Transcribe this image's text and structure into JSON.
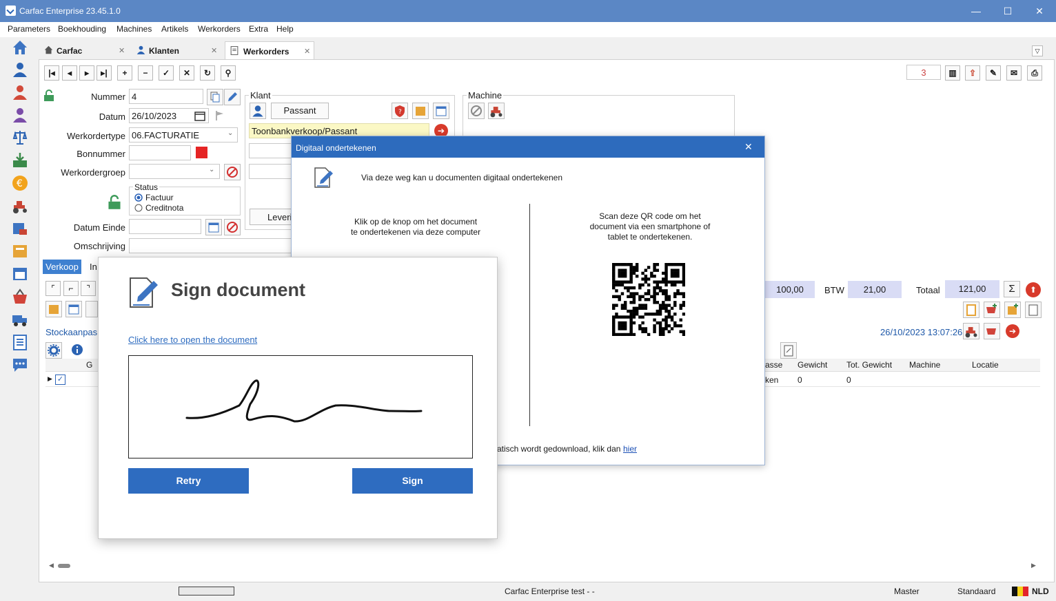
{
  "window": {
    "title": "Carfac Enterprise 23.45.1.0",
    "minimize": "—",
    "maximize": "☐",
    "close": "✕"
  },
  "menu": [
    "Parameters",
    "Boekhouding",
    "Machines",
    "Artikels",
    "Werkorders",
    "Extra",
    "Help"
  ],
  "tabs": [
    {
      "label": "Carfac",
      "icon": "home-icon"
    },
    {
      "label": "Klanten",
      "icon": "user-icon"
    },
    {
      "label": "Werkorders",
      "icon": "document-icon",
      "active": true
    }
  ],
  "toolbar": {
    "counter": "3"
  },
  "form": {
    "nummer_label": "Nummer",
    "nummer_value": "4",
    "datum_label": "Datum",
    "datum_value": "26/10/2023",
    "werkordertype_label": "Werkordertype",
    "werkordertype_value": "06.FACTURATIE",
    "bonnummer_label": "Bonnummer",
    "bonnummer_value": "",
    "werkordergroep_label": "Werkordergroep",
    "werkordergroep_value": "",
    "status_label": "Status",
    "status_options": [
      "Factuur",
      "Creditnota"
    ],
    "status_selected": "Factuur",
    "datum_einde_label": "Datum Einde",
    "omschrijving_label": "Omschrijving"
  },
  "klant": {
    "group_label": "Klant",
    "button_label": "Passant",
    "name_value": "Toonbankverkoop/Passant",
    "leveri_label": "Leveri"
  },
  "machine": {
    "group_label": "Machine"
  },
  "tabs_lower": {
    "verkoop": "Verkoop",
    "in": "In"
  },
  "stock_label": "Stockaanpas",
  "totals": {
    "subtotal": "100,00",
    "btw_label": "BTW",
    "btw_value": "21,00",
    "totaal_label": "Totaal",
    "totaal_value": "121,00"
  },
  "timestamp": "26/10/2023 13:07:26",
  "grid": {
    "columns": [
      "G",
      "asse",
      "Gewicht",
      "Tot. Gewicht",
      "Machine",
      "Locatie"
    ],
    "row": {
      "asse": "ken",
      "gewicht": "0",
      "tot_gewicht": "0"
    }
  },
  "dialog_digital": {
    "title": "Digitaal ondertekenen",
    "intro": "Via deze weg kan u documenten digitaal ondertekenen",
    "left_text_1": "Klik op de knop om het document",
    "left_text_2": "te ondertekenen via deze computer",
    "right_text_1": "Scan deze QR code om het",
    "right_text_2": "document via een smartphone of",
    "right_text_3": "tablet te ondertekenen.",
    "footer_text": "atisch wordt gedownload, klik dan",
    "footer_link": "hier"
  },
  "dialog_sign": {
    "title": "Sign document",
    "open_link": "Click here to open the document",
    "retry_label": "Retry",
    "sign_label": "Sign"
  },
  "statusbar": {
    "center": "Carfac Enterprise test -  -",
    "master": "Master",
    "standaard": "Standaard",
    "lang": "NLD"
  },
  "colors": {
    "accent": "#2e6cc0",
    "titlebar": "#5b87c5",
    "total_fill": "#d9dcf5"
  }
}
